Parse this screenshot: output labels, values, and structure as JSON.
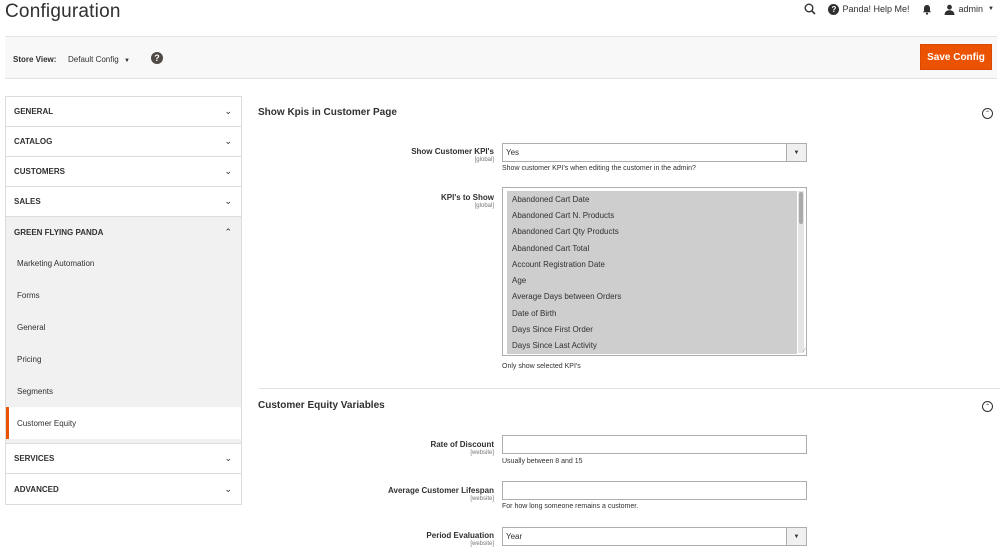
{
  "header": {
    "title": "Configuration",
    "help_label": "Panda! Help Me!",
    "user": "admin"
  },
  "store_bar": {
    "label": "Store View:",
    "value": "Default Config",
    "save_label": "Save Config"
  },
  "sidebar": {
    "sections_top": [
      {
        "label": "GENERAL"
      },
      {
        "label": "CATALOG"
      },
      {
        "label": "CUSTOMERS"
      },
      {
        "label": "SALES"
      }
    ],
    "expanded": {
      "label": "GREEN FLYING PANDA",
      "items": [
        {
          "label": "Marketing Automation"
        },
        {
          "label": "Forms"
        },
        {
          "label": "General"
        },
        {
          "label": "Pricing"
        },
        {
          "label": "Segments"
        },
        {
          "label": "Customer Equity"
        }
      ]
    },
    "sections_bottom": [
      {
        "label": "SERVICES"
      },
      {
        "label": "ADVANCED"
      }
    ]
  },
  "kpis": {
    "title": "Show Kpis in Customer Page",
    "show_label": "Show Customer KPI's",
    "show_scope": "[global]",
    "show_value": "Yes",
    "show_note": "Show customer KPI's when editing the customer in the admin?",
    "list_label": "KPI's to Show",
    "list_scope": "[global]",
    "options": [
      "Abandoned Cart Date",
      "Abandoned Cart N. Products",
      "Abandoned Cart Qty Products",
      "Abandoned Cart Total",
      "Account Registration Date",
      "Age",
      "Average Days between Orders",
      "Date of Birth",
      "Days Since First Order",
      "Days Since Last Activity"
    ],
    "list_note": "Only show selected KPI's"
  },
  "equity": {
    "title": "Customer Equity Variables",
    "discount_label": "Rate of Discount",
    "discount_scope": "[website]",
    "discount_value": "",
    "discount_note": "Usually between 8 and 15",
    "lifespan_label": "Average Customer Lifespan",
    "lifespan_scope": "[website]",
    "lifespan_value": "",
    "lifespan_note": "For how long someone remains a customer.",
    "period_label": "Period Evaluation",
    "period_scope": "[website]",
    "period_value": "Year"
  }
}
